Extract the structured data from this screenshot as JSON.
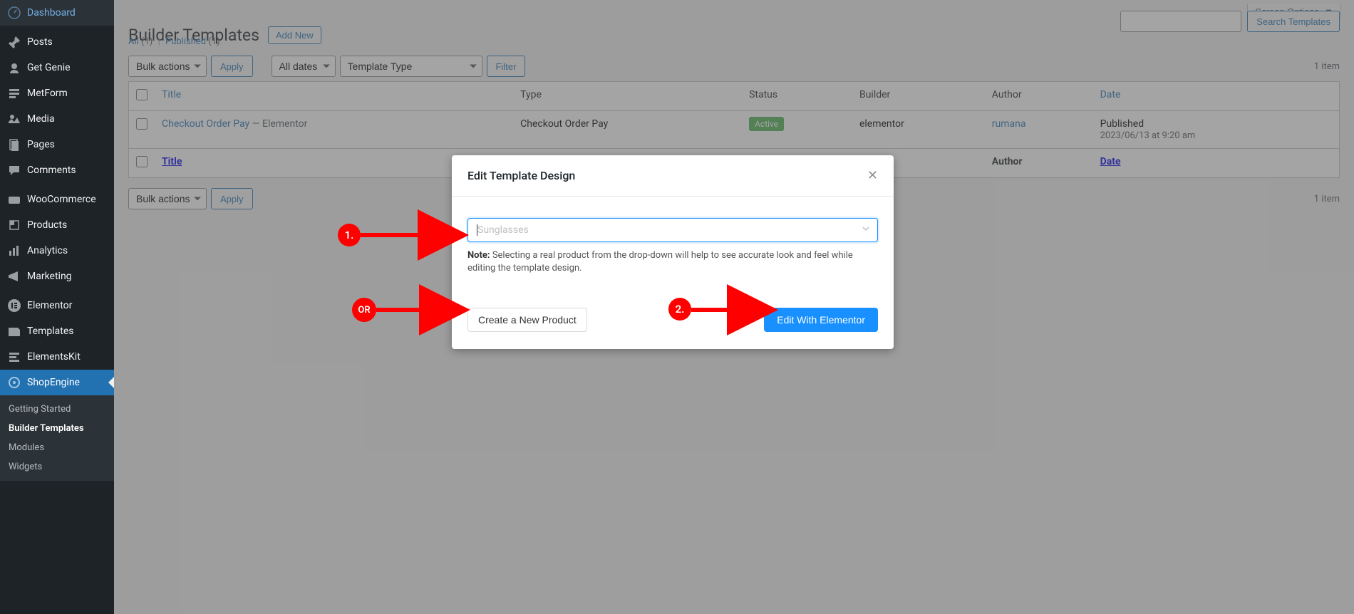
{
  "sidebar": {
    "items": [
      {
        "label": "Dashboard",
        "icon": "dashboard-icon"
      },
      {
        "label": "Posts",
        "icon": "pin-icon"
      },
      {
        "label": "Get Genie",
        "icon": "genie-icon"
      },
      {
        "label": "MetForm",
        "icon": "metform-icon"
      },
      {
        "label": "Media",
        "icon": "media-icon"
      },
      {
        "label": "Pages",
        "icon": "pages-icon"
      },
      {
        "label": "Comments",
        "icon": "comments-icon"
      },
      {
        "label": "WooCommerce",
        "icon": "woo-icon"
      },
      {
        "label": "Products",
        "icon": "products-icon"
      },
      {
        "label": "Analytics",
        "icon": "analytics-icon"
      },
      {
        "label": "Marketing",
        "icon": "marketing-icon"
      },
      {
        "label": "Elementor",
        "icon": "elementor-icon"
      },
      {
        "label": "Templates",
        "icon": "templates-icon"
      },
      {
        "label": "ElementsKit",
        "icon": "elementskit-icon"
      },
      {
        "label": "ShopEngine",
        "icon": "shopengine-icon"
      }
    ],
    "submenu": [
      {
        "label": "Getting Started"
      },
      {
        "label": "Builder Templates",
        "current": true
      },
      {
        "label": "Modules"
      },
      {
        "label": "Widgets"
      }
    ]
  },
  "header": {
    "screen_options": "Screen Options",
    "page_title": "Builder Templates",
    "add_new": "Add New"
  },
  "subsubsub": {
    "all_label": "All",
    "all_count": "(1)",
    "published_label": "Published",
    "published_count": "(1)"
  },
  "filters": {
    "bulk_actions": "Bulk actions",
    "apply": "Apply",
    "all_dates": "All dates",
    "template_type": "Template Type",
    "filter": "Filter",
    "item_count": "1 item",
    "search_button": "Search Templates"
  },
  "table": {
    "cols": {
      "title": "Title",
      "type": "Type",
      "status": "Status",
      "builder": "Builder",
      "author": "Author",
      "date": "Date"
    },
    "rows": [
      {
        "title": "Checkout Order Pay",
        "title_suffix": " — Elementor",
        "type": "Checkout Order Pay",
        "status": "Active",
        "builder": "elementor",
        "author": "rumana",
        "date_label": "Published",
        "date_value": "2023/06/13 at 9:20 am"
      }
    ]
  },
  "bottom": {
    "bulk_actions": "Bulk actions",
    "apply": "Apply",
    "item_count": "1 item"
  },
  "modal": {
    "title": "Edit Template Design",
    "product_placeholder": "Sunglasses",
    "note_label": "Note:",
    "note_text": " Selecting a real product from the drop-down will help to see accurate look and feel while editing the template design.",
    "create_product": "Create a New Product",
    "edit_with": "Edit With Elementor"
  },
  "annotations": {
    "one": "1.",
    "or": "OR",
    "two": "2."
  }
}
